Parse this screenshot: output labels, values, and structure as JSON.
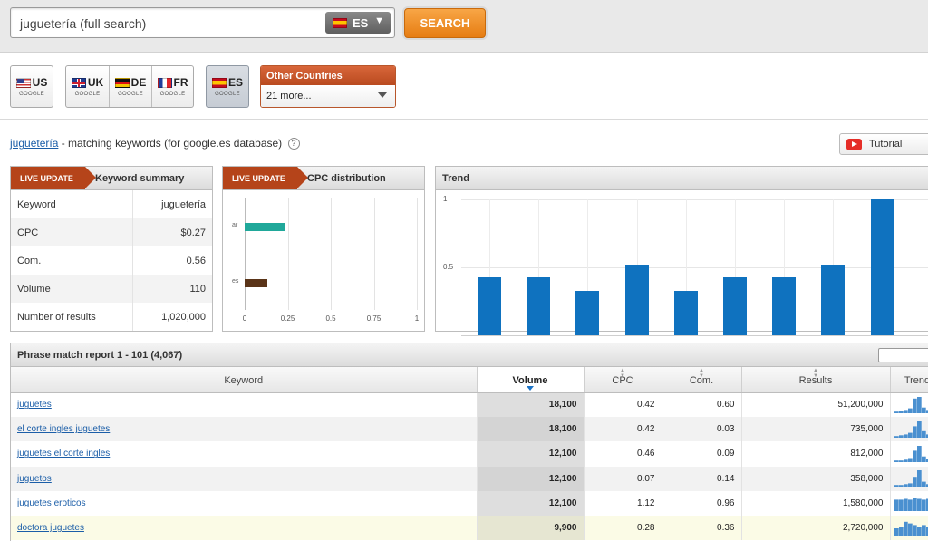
{
  "search": {
    "query": "juguetería (full search)",
    "database_code": "ES",
    "button_label": "SEARCH"
  },
  "countries": {
    "us": {
      "code": "US",
      "engine": "GOOGLE"
    },
    "uk": {
      "code": "UK",
      "engine": "GOOGLE"
    },
    "de": {
      "code": "DE",
      "engine": "GOOGLE"
    },
    "fr": {
      "code": "FR",
      "engine": "GOOGLE"
    },
    "es": {
      "code": "ES",
      "engine": "GOOGLE"
    },
    "other_title": "Other Countries",
    "other_selected": "21 more..."
  },
  "heading": {
    "keyword_link": "juguetería",
    "rest": " - matching keywords (for google.es database)",
    "help": "?"
  },
  "tutorial_label": "Tutorial",
  "live_label": "LIVE UPDATE",
  "summary": {
    "title": "Keyword summary",
    "rows": [
      {
        "label": "Keyword",
        "value": "juguetería"
      },
      {
        "label": "CPC",
        "value": "$0.27"
      },
      {
        "label": "Com.",
        "value": "0.56"
      },
      {
        "label": "Volume",
        "value": "110"
      },
      {
        "label": "Number of results",
        "value": "1,020,000"
      }
    ]
  },
  "cpc": {
    "title": "CPC distribution",
    "ticks": [
      "0",
      "0.25",
      "0.5",
      "0.75",
      "1"
    ],
    "bars": [
      {
        "label": "ar",
        "value": 0.23,
        "color": "#20a89a"
      },
      {
        "label": "es",
        "value": 0.13,
        "color": "#5a3418"
      }
    ]
  },
  "trend": {
    "title": "Trend",
    "y_ticks": [
      "1",
      "0.5"
    ],
    "values": [
      0.43,
      0.43,
      0.33,
      0.52,
      0.33,
      0.43,
      0.43,
      0.52,
      1.0
    ],
    "color": "#0f72bf"
  },
  "report": {
    "title": "Phrase match report 1 - 101 (4,067)",
    "columns": [
      "Keyword",
      "Volume",
      "CPC",
      "Com.",
      "Results",
      "Trend"
    ],
    "rows": [
      {
        "keyword": "juguetes",
        "volume": "18,100",
        "cpc": "0.42",
        "com": "0.60",
        "results": "51,200,000",
        "trend": [
          0.1,
          0.15,
          0.2,
          0.3,
          0.9,
          1.0,
          0.35,
          0.2,
          0.15,
          0.1
        ]
      },
      {
        "keyword": "el corte ingles juguetes",
        "volume": "18,100",
        "cpc": "0.42",
        "com": "0.03",
        "results": "735,000",
        "trend": [
          0.1,
          0.15,
          0.2,
          0.3,
          0.7,
          1.0,
          0.4,
          0.2,
          0.15,
          0.1
        ]
      },
      {
        "keyword": "juguetes el corte ingles",
        "volume": "12,100",
        "cpc": "0.46",
        "com": "0.09",
        "results": "812,000",
        "trend": [
          0.1,
          0.1,
          0.15,
          0.25,
          0.7,
          1.0,
          0.35,
          0.2,
          0.1,
          0.1
        ]
      },
      {
        "keyword": "juguetos",
        "volume": "12,100",
        "cpc": "0.07",
        "com": "0.14",
        "results": "358,000",
        "trend": [
          0.1,
          0.1,
          0.15,
          0.2,
          0.6,
          1.0,
          0.3,
          0.15,
          0.1,
          0.1
        ]
      },
      {
        "keyword": "juguetes eroticos",
        "volume": "12,100",
        "cpc": "1.12",
        "com": "0.96",
        "results": "1,580,000",
        "trend": [
          0.7,
          0.7,
          0.75,
          0.7,
          0.8,
          0.75,
          0.7,
          0.75,
          0.7,
          0.75
        ]
      },
      {
        "keyword": "doctora juguetes",
        "volume": "9,900",
        "cpc": "0.28",
        "com": "0.36",
        "results": "2,720,000",
        "trend": [
          0.5,
          0.6,
          0.9,
          0.8,
          0.7,
          0.6,
          0.7,
          0.6,
          0.55,
          0.5
        ]
      }
    ]
  }
}
